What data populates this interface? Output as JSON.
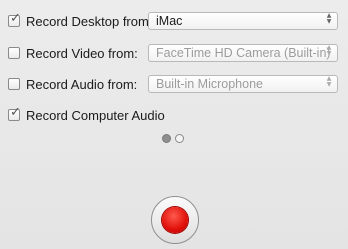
{
  "rows": [
    {
      "label": "Record Desktop from:",
      "checked": true,
      "popup": {
        "value": "iMac",
        "disabled": false
      }
    },
    {
      "label": "Record Video from:",
      "checked": false,
      "popup": {
        "value": "FaceTime HD Camera (Built-in)",
        "disabled": true
      }
    },
    {
      "label": "Record Audio from:",
      "checked": false,
      "popup": {
        "value": "Built-in Microphone",
        "disabled": true
      }
    },
    {
      "label": "Record Computer Audio",
      "checked": true
    }
  ],
  "checkmark_glyph": "✓",
  "popup_arrows": {
    "up": "▲",
    "down": "▼"
  },
  "pager": {
    "pages": 2,
    "current": 1
  },
  "record_button": {
    "icon": "record-icon",
    "color": "#e0100a"
  }
}
